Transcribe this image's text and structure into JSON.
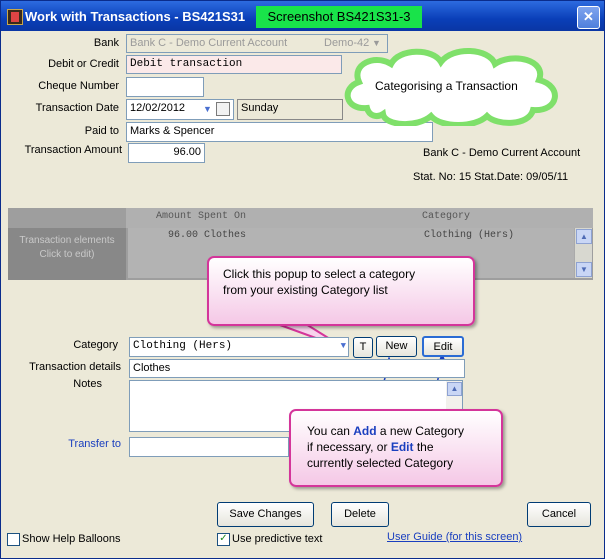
{
  "window": {
    "title": "Work with Transactions - BS421S31",
    "screenshot_badge": "Screenshot BS421S31-3",
    "close_glyph": "✕"
  },
  "form": {
    "bank_label": "Bank",
    "bank_value": "Bank C - Demo Current Account",
    "bank_code": "Demo-42",
    "debit_credit_label": "Debit or Credit",
    "debit_credit_value": "Debit transaction",
    "cheque_label": "Cheque Number",
    "cheque_value": "",
    "date_label": "Transaction Date",
    "date_value": "12/02/2012",
    "day_value": "Sunday",
    "paid_to_label": "Paid to",
    "paid_to_value": "Marks & Spencer",
    "amount_label": "Transaction Amount",
    "amount_value": "96.00"
  },
  "account_info": {
    "account_name": "Bank C - Demo Current Account",
    "statement": "Stat. No: 15  Stat.Date: 09/05/11"
  },
  "elements_grid": {
    "side_label_line1": "Transaction elements",
    "side_label_line2": "Click to edit)",
    "col_amount_header": "Amount Spent On",
    "col_category_header": "Category",
    "row_amount": "96.00 Clothes",
    "row_category": "Clothing (Hers)"
  },
  "category": {
    "label": "Category",
    "value": "Clothing (Hers)",
    "t_button": "T",
    "new_button": "New",
    "edit_button": "Edit"
  },
  "details": {
    "label": "Transaction details",
    "value": "Clothes",
    "notes_label": "Notes",
    "transfer_label": "Transfer to"
  },
  "callouts": {
    "cloud_text": "Categorising a Transaction",
    "popup_line1": "Click this popup to select a category",
    "popup_line2": "from your existing Category list",
    "bottom_line1_pre": "You can ",
    "bottom_add": "Add",
    "bottom_line1_post": " a new Category",
    "bottom_line2_pre": "if necessary, or ",
    "bottom_edit": "Edit",
    "bottom_line2_post": " the",
    "bottom_line3": "currently selected Category"
  },
  "buttons": {
    "save": "Save Changes",
    "delete": "Delete",
    "cancel": "Cancel"
  },
  "footer": {
    "show_help": "Show Help Balloons",
    "predictive": "Use predictive text",
    "user_guide": "User Guide (for this screen)"
  },
  "colors": {
    "titlebar": "#0a3fb8",
    "badge": "#19e34a",
    "callout_border": "#d4359a",
    "link": "#1a3fbf"
  }
}
